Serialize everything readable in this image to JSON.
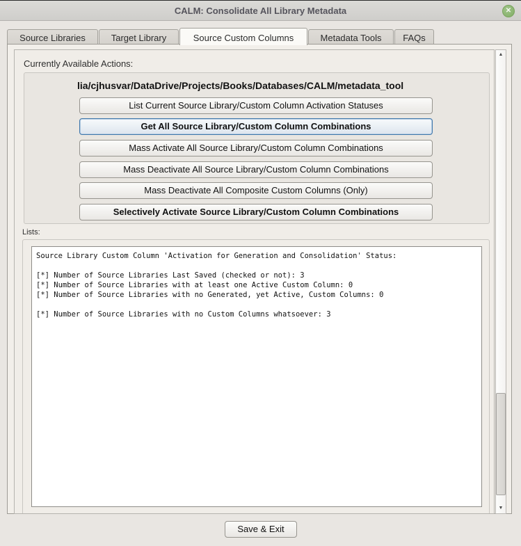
{
  "window": {
    "title": "CALM: Consolidate All Library Metadata",
    "close_icon": "✕"
  },
  "tabs": [
    {
      "label": "Source Libraries"
    },
    {
      "label": "Target Library"
    },
    {
      "label": "Source Custom Columns",
      "active": true
    },
    {
      "label": "Metadata Tools"
    },
    {
      "label": "FAQs"
    }
  ],
  "actions": {
    "frame_label": "Currently Available Actions:",
    "path_text": "lia/cjhusvar/DataDrive/Projects/Books/Databases/CALM/metadata_tool",
    "buttons": [
      {
        "label": "List Current Source Library/Custom Column Activation Statuses"
      },
      {
        "label": "Get All Source Library/Custom Column Combinations",
        "bold": true,
        "focused": true
      },
      {
        "label": "Mass Activate All Source Library/Custom Column Combinations"
      },
      {
        "label": "Mass Deactivate All Source Library/Custom Column Combinations"
      },
      {
        "label": "Mass Deactivate All Composite Custom Columns (Only)"
      },
      {
        "label": "Selectively Activate Source Library/Custom Column Combinations",
        "bold": true
      }
    ]
  },
  "lists": {
    "frame_label": "Lists:",
    "text": "Source Library Custom Column 'Activation for Generation and Consolidation' Status:\n\n[*] Number of Source Libraries Last Saved (checked or not): 3\n[*] Number of Source Libraries with at least one Active Custom Column: 0\n[*] Number of Source Libraries with no Generated, yet Active, Custom Columns: 0\n\n[*] Number of Source Libraries with no Custom Columns whatsoever: 3"
  },
  "scrollbar": {
    "up_icon": "▲",
    "down_icon": "▼"
  },
  "footer": {
    "save_exit_label": "Save & Exit"
  },
  "colors": {
    "window_bg": "#e9e6e2",
    "page_bg": "#f0ede8",
    "frame_bg": "#e9e6e1",
    "focus_border": "#3f77ab",
    "close_green": "#82ae66",
    "output_bg": "#ffffff"
  }
}
